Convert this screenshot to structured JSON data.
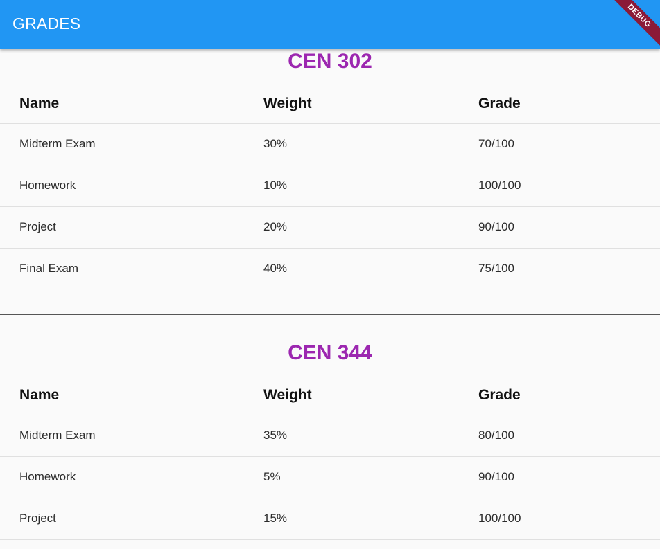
{
  "app_bar": {
    "title": "GRADES",
    "debug_label": "DEBUG",
    "color": "#2196f3"
  },
  "accent_color": "#9c27b0",
  "courses": [
    {
      "title": "CEN 302",
      "headers": {
        "name": "Name",
        "weight": "Weight",
        "grade": "Grade"
      },
      "rows": [
        {
          "name": "Midterm Exam",
          "weight": "30%",
          "grade": "70/100"
        },
        {
          "name": "Homework",
          "weight": "10%",
          "grade": "100/100"
        },
        {
          "name": "Project",
          "weight": "20%",
          "grade": "90/100"
        },
        {
          "name": "Final Exam",
          "weight": "40%",
          "grade": "75/100"
        }
      ]
    },
    {
      "title": "CEN 344",
      "headers": {
        "name": "Name",
        "weight": "Weight",
        "grade": "Grade"
      },
      "rows": [
        {
          "name": "Midterm Exam",
          "weight": "35%",
          "grade": "80/100"
        },
        {
          "name": "Homework",
          "weight": "5%",
          "grade": "90/100"
        },
        {
          "name": "Project",
          "weight": "15%",
          "grade": "100/100"
        }
      ]
    }
  ]
}
